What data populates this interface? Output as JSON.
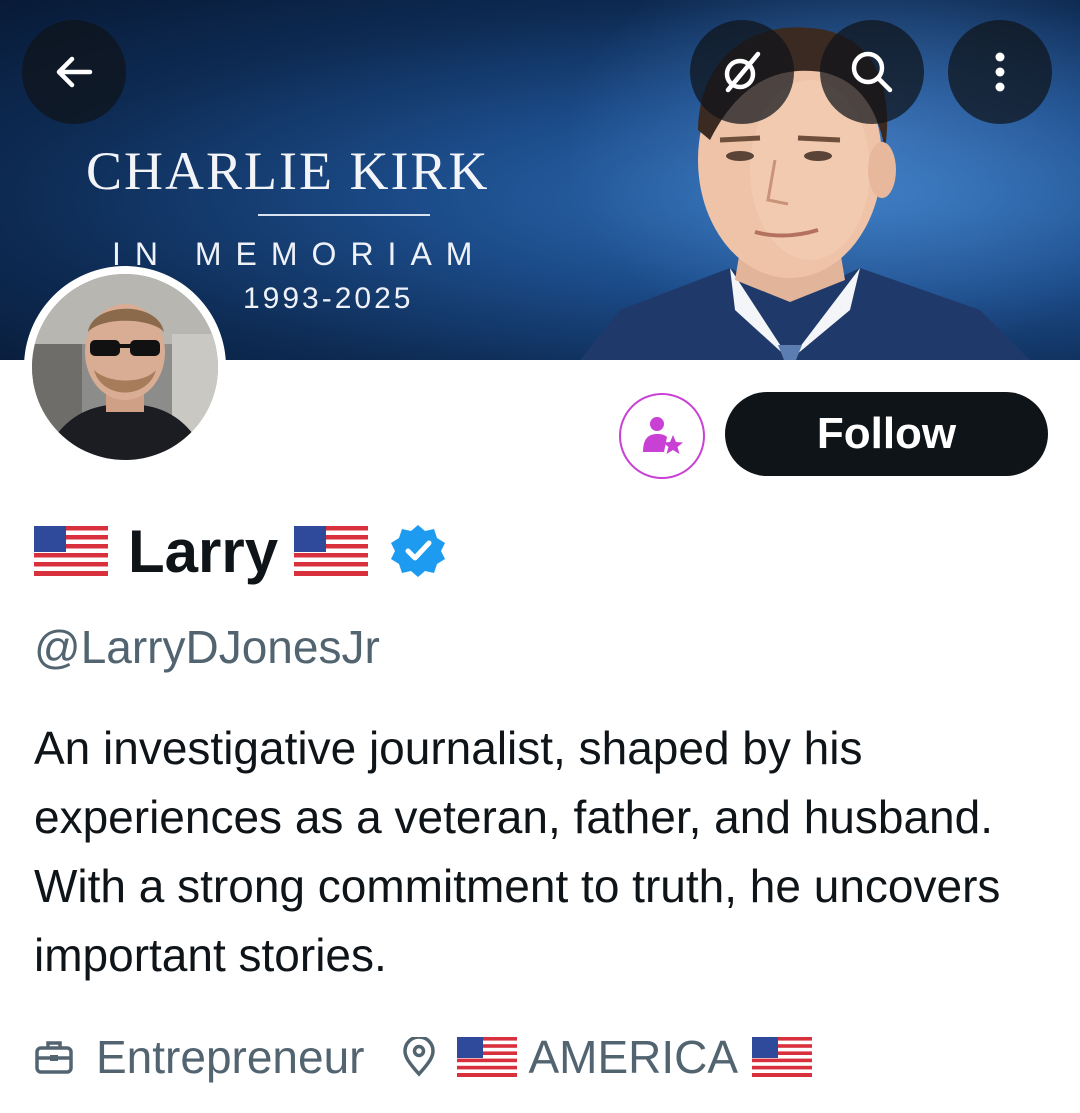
{
  "banner": {
    "title": "CHARLIE KIRK",
    "subtitle": "IN MEMORIAM",
    "years": "1993-2025"
  },
  "nav": {
    "back_icon": "back-arrow-icon",
    "grok_icon": "grok-icon",
    "search_icon": "search-icon",
    "more_icon": "more-vertical-icon"
  },
  "actions": {
    "subscribe_icon": "subscribe-person-star-icon",
    "follow_label": "Follow"
  },
  "profile": {
    "display_name": "Larry",
    "name_flag_icon": "us-flag-emoji",
    "verified_icon": "verified-badge-icon",
    "handle": "@LarryDJonesJr",
    "bio": "An investigative journalist, shaped by his experiences as a veteran, father, and husband. With a strong commitment to truth, he uncovers important stories.",
    "profession_icon": "briefcase-icon",
    "profession": "Entrepreneur",
    "location_icon": "location-pin-icon",
    "location": "AMERICA"
  },
  "colors": {
    "follow_bg": "#0f1419",
    "subscribe_accent": "#c940d4",
    "verified_blue": "#1d9bf0",
    "secondary_text": "#536471"
  }
}
